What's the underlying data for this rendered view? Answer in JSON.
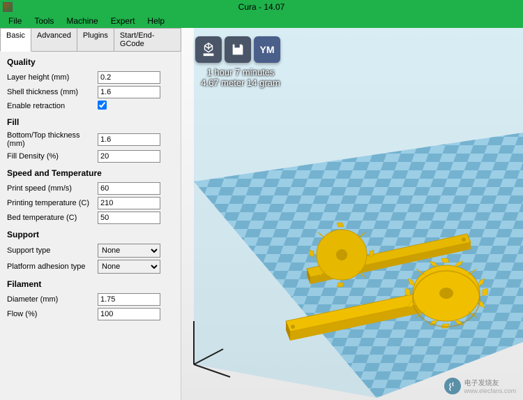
{
  "window": {
    "title": "Cura - 14.07"
  },
  "menu": {
    "items": [
      "File",
      "Tools",
      "Machine",
      "Expert",
      "Help"
    ]
  },
  "tabs": {
    "items": [
      "Basic",
      "Advanced",
      "Plugins",
      "Start/End-GCode"
    ],
    "active": 0
  },
  "sections": {
    "quality": {
      "title": "Quality",
      "layer_height_label": "Layer height (mm)",
      "layer_height": "0.2",
      "shell_thickness_label": "Shell thickness (mm)",
      "shell_thickness": "1.6",
      "enable_retraction_label": "Enable retraction",
      "enable_retraction": true
    },
    "fill": {
      "title": "Fill",
      "bottom_top_label": "Bottom/Top thickness (mm)",
      "bottom_top": "1.6",
      "fill_density_label": "Fill Density (%)",
      "fill_density": "20"
    },
    "speed_temp": {
      "title": "Speed and Temperature",
      "print_speed_label": "Print speed (mm/s)",
      "print_speed": "60",
      "printing_temp_label": "Printing temperature (C)",
      "printing_temp": "210",
      "bed_temp_label": "Bed temperature (C)",
      "bed_temp": "50"
    },
    "support": {
      "title": "Support",
      "support_type_label": "Support type",
      "support_type": "None",
      "platform_adhesion_label": "Platform adhesion type",
      "platform_adhesion": "None"
    },
    "filament": {
      "title": "Filament",
      "diameter_label": "Diameter (mm)",
      "diameter": "1.75",
      "flow_label": "Flow (%)",
      "flow": "100"
    }
  },
  "viewport": {
    "toolbar": {
      "ym_label": "YM"
    },
    "info": {
      "time": "1 hour 7 minutes",
      "material": "4.67 meter 14 gram"
    }
  },
  "watermark": {
    "brand": "电子发烧友",
    "url": "www.elecfans.com"
  }
}
